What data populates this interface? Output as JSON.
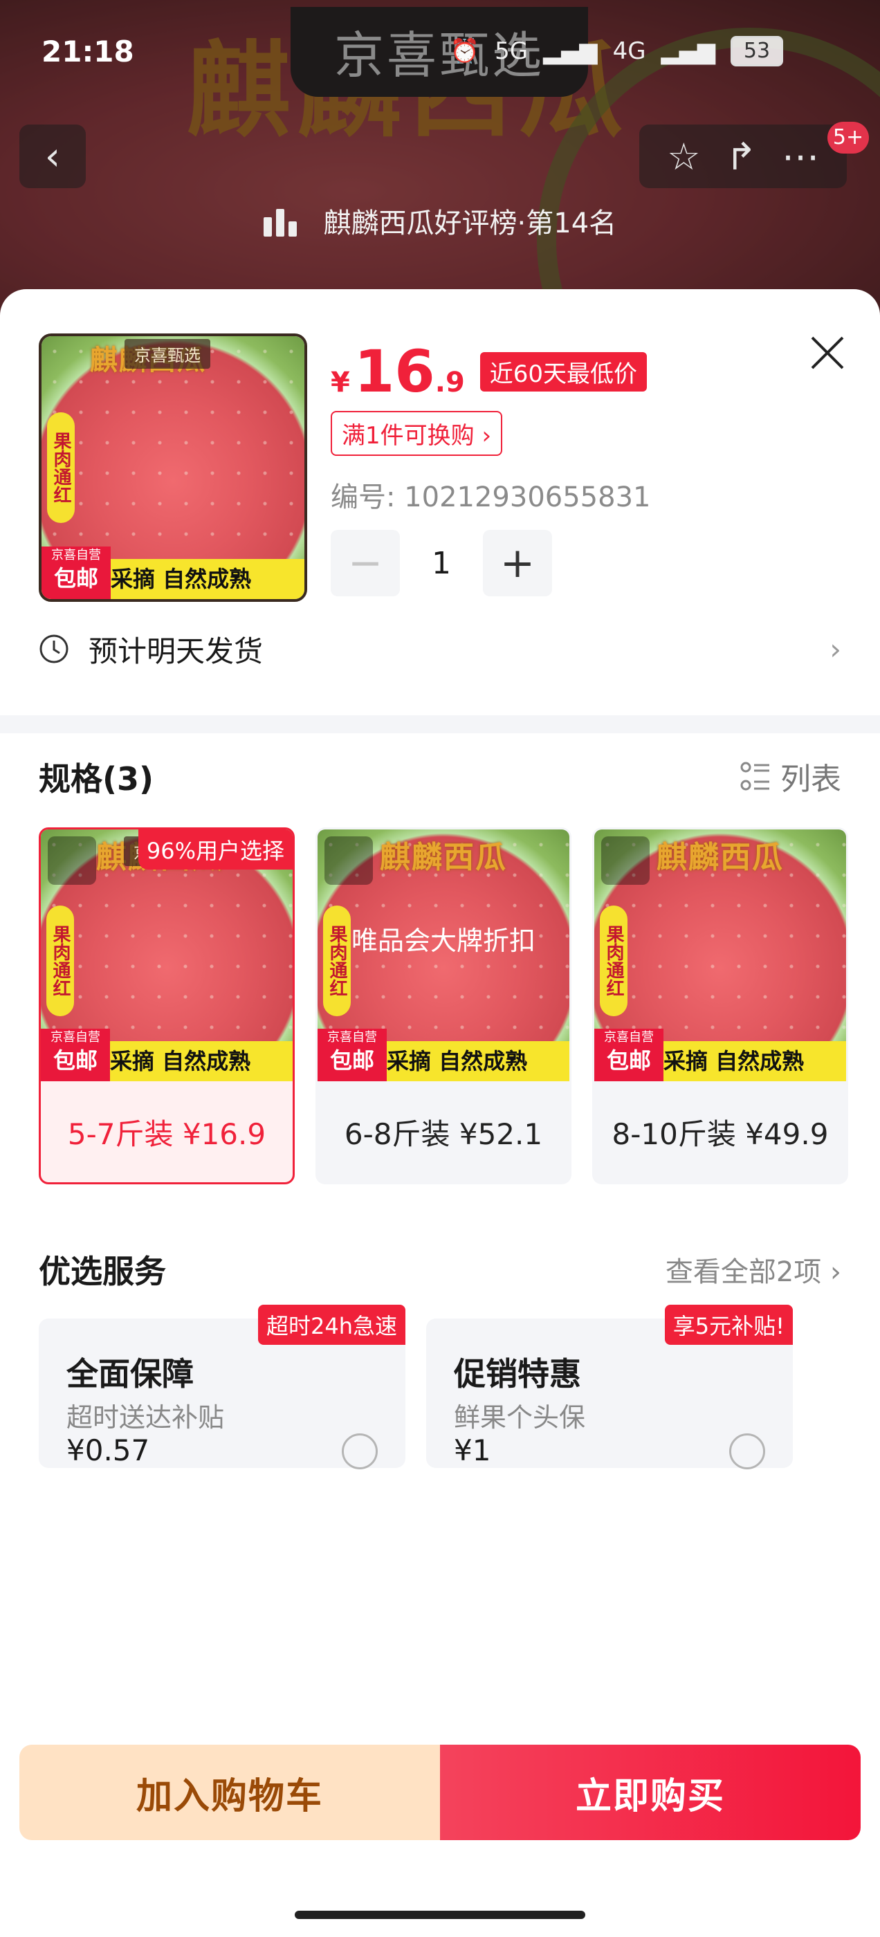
{
  "status_bar": {
    "time": "21:18",
    "network_1": "5G",
    "network_2": "4G",
    "battery": "53"
  },
  "background_page": {
    "store_name": "京喜甄选",
    "banner_text": "麒麟西瓜",
    "rank_text": "麒麟西瓜好评榜·第14名",
    "notification_count": "5+"
  },
  "product": {
    "thumb": {
      "title": "麒麟西瓜",
      "brand": "京喜甄选",
      "side_tag": "果肉通红",
      "strip": "采摘  自然成熟",
      "ship_small": "京喜自营",
      "ship_big": "包邮"
    },
    "price_symbol": "¥",
    "price_int": "16",
    "price_dec": ".9",
    "low_price_tag": "近60天最低价",
    "swap_tag": "满1件可换购",
    "sku_code": "编号: 10212930655831",
    "quantity": "1",
    "shipping_eta": "预计明天发货"
  },
  "specs": {
    "title": "规格(3)",
    "list_toggle": "列表",
    "items": [
      {
        "label": "5-7斤装 ¥16.9",
        "badge": "96%用户选择",
        "overlay": "",
        "selected": true
      },
      {
        "label": "6-8斤装 ¥52.1",
        "badge": "",
        "overlay": "唯品会大牌折扣",
        "selected": false
      },
      {
        "label": "8-10斤装 ¥49.9",
        "badge": "",
        "overlay": "",
        "selected": false
      }
    ],
    "card_art": {
      "title": "麒麟西瓜",
      "brand": "京喜甄选",
      "side_tag": "果肉通红",
      "strip": "采摘  自然成熟",
      "ship_small": "京喜自营",
      "ship_big": "包邮"
    }
  },
  "services": {
    "title": "优选服务",
    "view_all": "查看全部2项",
    "items": [
      {
        "name": "全面保障",
        "sub": "超时送达补贴",
        "price": "¥0.57",
        "badge": "超时24h急速"
      },
      {
        "name": "促销特惠",
        "sub": "鲜果个头保",
        "price": "¥1",
        "badge": "享5元补贴!"
      }
    ]
  },
  "actions": {
    "add_to_cart": "加入购物车",
    "buy_now": "立即购买"
  },
  "colors": {
    "accent_red": "#f0213a",
    "cart_bg": "#ffe2c4",
    "cart_text": "#9a4a07"
  }
}
